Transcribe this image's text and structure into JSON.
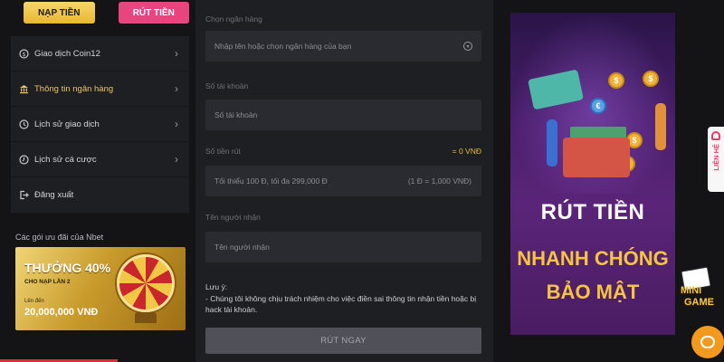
{
  "top_buttons": {
    "deposit": "NẠP TIỀN",
    "withdraw": "RÚT TIỀN"
  },
  "menu": {
    "items": [
      {
        "label": "Giao dịch Coin12",
        "icon": "coin-icon"
      },
      {
        "label": "Thông tin ngân hàng",
        "icon": "bank-icon",
        "active": true
      },
      {
        "label": "Lịch sử giao dịch",
        "icon": "history-icon"
      },
      {
        "label": "Lịch sử cá cược",
        "icon": "bet-history-icon"
      },
      {
        "label": "Đăng xuất",
        "icon": "logout-icon"
      }
    ]
  },
  "promo": {
    "section_title": "Các gói ưu đãi của Nbet",
    "headline": "THƯỞNG 40%",
    "subline": "CHO NẠP LẦN 2",
    "amount_label": "Lên đến",
    "amount": "20,000,000 VNĐ"
  },
  "form": {
    "bank_label": "Chọn ngân hàng",
    "bank_placeholder": "Nhập tên hoặc chọn ngân hàng của bạn",
    "account_label": "Số tài khoản",
    "account_placeholder": "Số tài khoản",
    "amount_label": "Số tiền rút",
    "amount_equal": "= 0 VNĐ",
    "amount_placeholder": "Tối thiểu 100 Đ, tối đa 299,000 Đ",
    "amount_hint": "(1 Đ = 1,000 VNĐ)",
    "name_label": "Tên người nhận",
    "name_placeholder": "Tên người nhận",
    "note_title": "Lưu ý:",
    "note_text": "- Chúng tôi không chịu trách nhiệm cho việc điền sai thông tin nhận tiền hoặc bị hack tài khoản.",
    "submit_label": "RÚT NGAY"
  },
  "banner": {
    "line1": "RÚT TIỀN",
    "line2": "NHANH CHÓNG",
    "line3": "BẢO MẬT",
    "coin_symbol": "$",
    "euro_symbol": "€"
  },
  "contact": {
    "label": "LIÊN HỆ"
  },
  "logo": {
    "line1": "MINI",
    "line2": "GAME"
  },
  "colors": {
    "deposit_btn": "#eab730",
    "withdraw_btn": "#e8457f",
    "active_menu": "#e8c564",
    "amount_equal": "#e4b93b"
  }
}
